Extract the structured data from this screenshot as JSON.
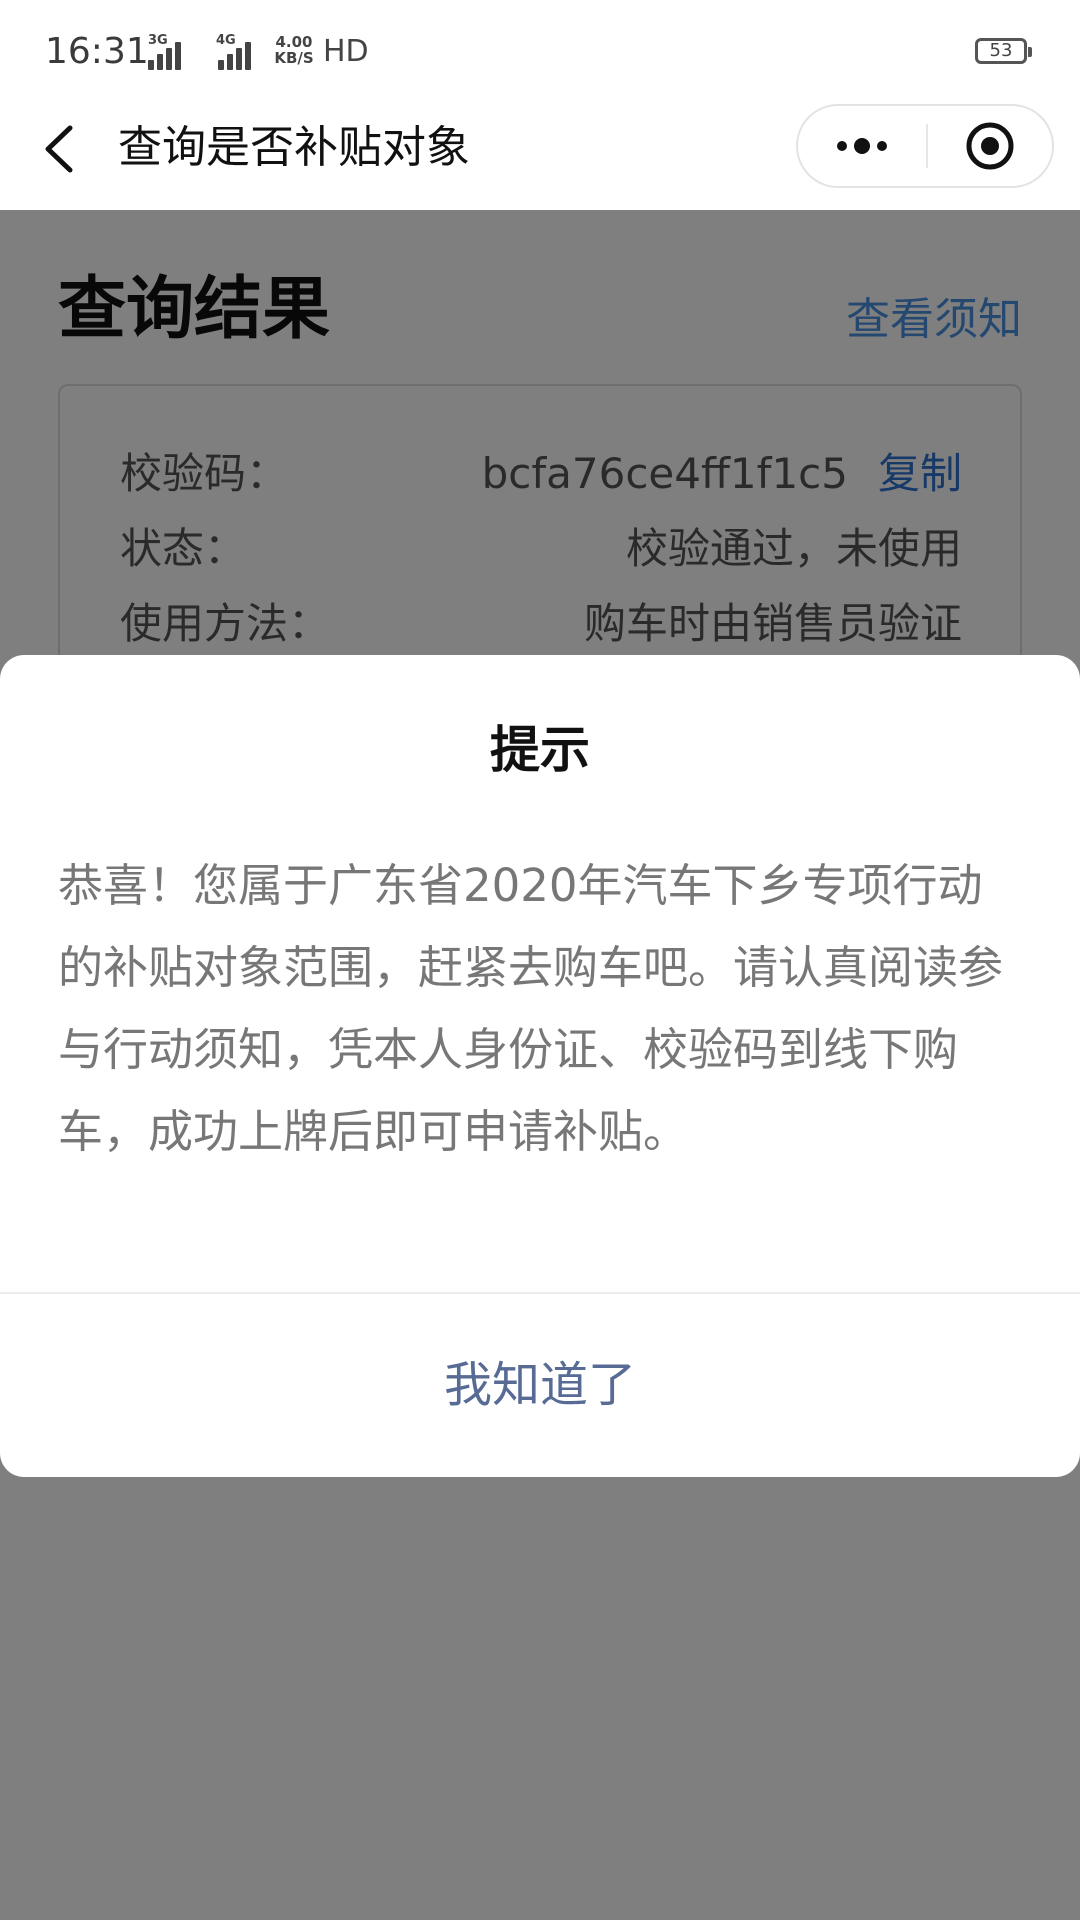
{
  "status_bar": {
    "time": "16:31",
    "network_1": "3G",
    "network_2": "4G",
    "speed_value": "4.00",
    "speed_unit": "KB/S",
    "hd": "HD",
    "battery": "53"
  },
  "nav": {
    "title": "查询是否补贴对象"
  },
  "page": {
    "result_title": "查询结果",
    "notice_link": "查看须知",
    "rows": [
      {
        "label": "校验码：",
        "value": "bcfa76ce4ff1f1c5",
        "action": "复制"
      },
      {
        "label": "状态：",
        "value": "校验通过，未使用"
      },
      {
        "label": "使用方法：",
        "value": "购车时由销售员验证"
      }
    ]
  },
  "dialog": {
    "title": "提示",
    "body": "恭喜！您属于广东省2020年汽车下乡专项行动的补贴对象范围，赶紧去购车吧。请认真阅读参与行动须知，凭本人身份证、校验码到线下购车，成功上牌后即可申请补贴。",
    "confirm_label": "我知道了"
  },
  "colors": {
    "link_blue": "#4a90e2",
    "copy_blue": "#2f72d0",
    "dialog_button": "#576b95"
  }
}
